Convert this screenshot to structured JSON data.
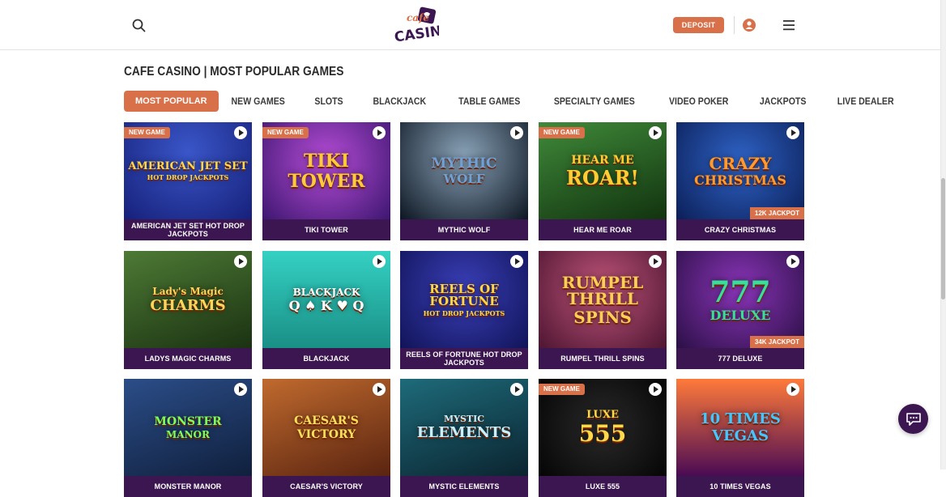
{
  "header": {
    "logo_line1": "cafe",
    "logo_line2": "CASINO",
    "deposit_label": "DEPOSIT"
  },
  "page": {
    "title": "CAFE CASINO | MOST POPULAR GAMES"
  },
  "tabs": [
    {
      "label": "MOST POPULAR",
      "active": true
    },
    {
      "label": "NEW GAMES"
    },
    {
      "label": "SLOTS"
    },
    {
      "label": "BLACKJACK"
    },
    {
      "label": "TABLE GAMES"
    },
    {
      "label": "SPECIALTY GAMES"
    },
    {
      "label": "VIDEO POKER"
    },
    {
      "label": "JACKPOTS"
    },
    {
      "label": "LIVE DEALER"
    }
  ],
  "games": [
    {
      "name": "AMERICAN JET SET HOT DROP JACKPOTS",
      "art": "AMERICAN JET SET",
      "art2": "HOT DROP JACKPOTS",
      "badge_new": "NEW GAME",
      "jackpot": ""
    },
    {
      "name": "TIKI TOWER",
      "art": "TIKI",
      "art2": "TOWER",
      "badge_new": "NEW GAME",
      "jackpot": ""
    },
    {
      "name": "MYTHIC WOLF",
      "art": "MYTHIC",
      "art2": "WOLF",
      "badge_new": "",
      "jackpot": ""
    },
    {
      "name": "HEAR ME ROAR",
      "art": "HEAR ME",
      "art2": "ROAR!",
      "badge_new": "NEW GAME",
      "jackpot": ""
    },
    {
      "name": "CRAZY CHRISTMAS",
      "art": "CRAZY",
      "art2": "CHRISTMAS",
      "badge_new": "",
      "jackpot": "12K JACKPOT"
    },
    {
      "name": "LADYS MAGIC CHARMS",
      "art": "Lady's Magic",
      "art2": "CHARMS",
      "badge_new": "",
      "jackpot": ""
    },
    {
      "name": "BLACKJACK",
      "art": "BLACKJACK",
      "art2": "Q ♠ K ♥ Q",
      "badge_new": "",
      "jackpot": ""
    },
    {
      "name": "REELS OF FORTUNE HOT DROP JACKPOTS",
      "art": "REELS OF FORTUNE",
      "art2": "HOT DROP JACKPOTS",
      "badge_new": "",
      "jackpot": ""
    },
    {
      "name": "RUMPEL THRILL SPINS",
      "art": "RUMPEL THRILL",
      "art2": "SPINS",
      "badge_new": "",
      "jackpot": ""
    },
    {
      "name": "777 DELUXE",
      "art": "777",
      "art2": "DELUXE",
      "badge_new": "",
      "jackpot": "34K JACKPOT"
    },
    {
      "name": "MONSTER MANOR",
      "art": "MONSTER",
      "art2": "MANOR",
      "badge_new": "",
      "jackpot": ""
    },
    {
      "name": "CAESAR'S VICTORY",
      "art": "CAESAR'S",
      "art2": "VICTORY",
      "badge_new": "",
      "jackpot": ""
    },
    {
      "name": "MYSTIC ELEMENTS",
      "art": "MYSTIC",
      "art2": "ELEMENTS",
      "badge_new": "",
      "jackpot": ""
    },
    {
      "name": "LUXE 555",
      "art": "LUXE",
      "art2": "555",
      "badge_new": "NEW GAME",
      "jackpot": ""
    },
    {
      "name": "10 TIMES VEGAS",
      "art": "10 TIMES",
      "art2": "VEGAS",
      "badge_new": "",
      "jackpot": ""
    }
  ],
  "colors": {
    "accent": "#d8704a",
    "caption_bg": "#3c1650"
  }
}
